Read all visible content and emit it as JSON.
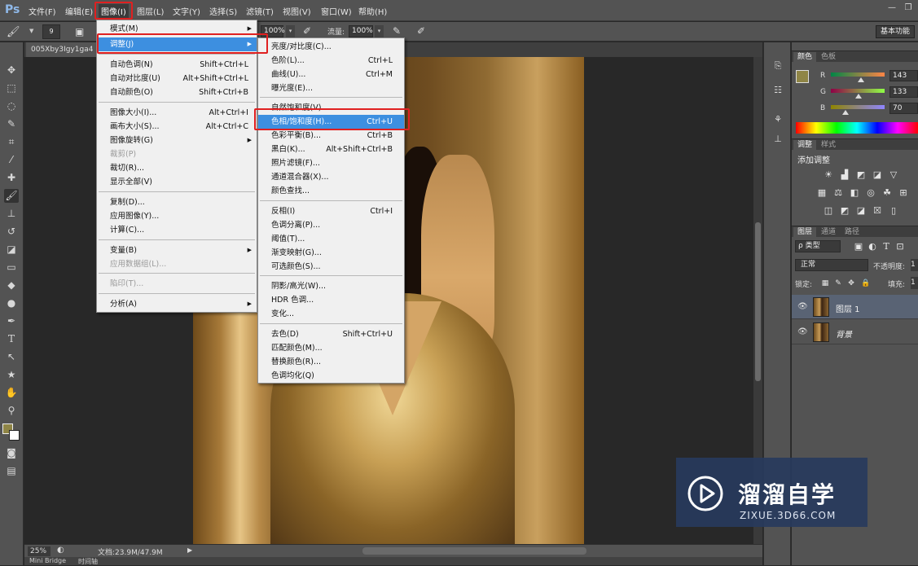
{
  "app": {
    "logo": "Ps"
  },
  "menubar": [
    "文件(F)",
    "编辑(E)",
    "图像(I)",
    "图层(L)",
    "文字(Y)",
    "选择(S)",
    "滤镜(T)",
    "视图(V)",
    "窗口(W)",
    "帮助(H)"
  ],
  "window_controls": {
    "minimize": "—",
    "restore": "❐"
  },
  "options": {
    "brush_size": "9",
    "opacity_value": "100%",
    "flow_label": "流量:",
    "flow_value": "100%",
    "workspace": "基本功能"
  },
  "document": {
    "tab": "005Xby3Igy1ga4",
    "zoom": "25%",
    "doc_size": "文档:23.9M/47.9M",
    "bottom_tabs": [
      "Mini Bridge",
      "时间轴"
    ]
  },
  "image_menu": {
    "items": [
      {
        "label": "模式(M)",
        "shortcut": "",
        "submenu": true,
        "disabled": false
      },
      {
        "label": "调整(J)",
        "shortcut": "",
        "submenu": true,
        "disabled": false,
        "highlight": true
      },
      {
        "label": "自动色调(N)",
        "shortcut": "Shift+Ctrl+L"
      },
      {
        "label": "自动对比度(U)",
        "shortcut": "Alt+Shift+Ctrl+L"
      },
      {
        "label": "自动颜色(O)",
        "shortcut": "Shift+Ctrl+B"
      },
      {
        "label": "图像大小(I)...",
        "shortcut": "Alt+Ctrl+I"
      },
      {
        "label": "画布大小(S)...",
        "shortcut": "Alt+Ctrl+C"
      },
      {
        "label": "图像旋转(G)",
        "shortcut": "",
        "submenu": true
      },
      {
        "label": "裁剪(P)",
        "shortcut": "",
        "disabled": true
      },
      {
        "label": "裁切(R)...",
        "shortcut": ""
      },
      {
        "label": "显示全部(V)",
        "shortcut": ""
      },
      {
        "label": "复制(D)...",
        "shortcut": ""
      },
      {
        "label": "应用图像(Y)...",
        "shortcut": ""
      },
      {
        "label": "计算(C)...",
        "shortcut": ""
      },
      {
        "label": "变量(B)",
        "shortcut": "",
        "submenu": true
      },
      {
        "label": "应用数据组(L)...",
        "shortcut": "",
        "disabled": true
      },
      {
        "label": "陷印(T)...",
        "shortcut": "",
        "disabled": true
      },
      {
        "label": "分析(A)",
        "shortcut": "",
        "submenu": true
      }
    ]
  },
  "adjust_menu": {
    "items": [
      {
        "label": "亮度/对比度(C)...",
        "shortcut": ""
      },
      {
        "label": "色阶(L)...",
        "shortcut": "Ctrl+L"
      },
      {
        "label": "曲线(U)...",
        "shortcut": "Ctrl+M"
      },
      {
        "label": "曝光度(E)...",
        "shortcut": ""
      },
      {
        "label": "自然饱和度(V)...",
        "shortcut": ""
      },
      {
        "label": "色相/饱和度(H)...",
        "shortcut": "Ctrl+U",
        "highlight": true
      },
      {
        "label": "色彩平衡(B)...",
        "shortcut": "Ctrl+B"
      },
      {
        "label": "黑白(K)...",
        "shortcut": "Alt+Shift+Ctrl+B"
      },
      {
        "label": "照片滤镜(F)...",
        "shortcut": ""
      },
      {
        "label": "通道混合器(X)...",
        "shortcut": ""
      },
      {
        "label": "颜色查找...",
        "shortcut": ""
      },
      {
        "label": "反相(I)",
        "shortcut": "Ctrl+I"
      },
      {
        "label": "色调分离(P)...",
        "shortcut": ""
      },
      {
        "label": "阈值(T)...",
        "shortcut": ""
      },
      {
        "label": "渐变映射(G)...",
        "shortcut": ""
      },
      {
        "label": "可选颜色(S)...",
        "shortcut": ""
      },
      {
        "label": "阴影/高光(W)...",
        "shortcut": ""
      },
      {
        "label": "HDR 色调...",
        "shortcut": ""
      },
      {
        "label": "变化...",
        "shortcut": ""
      },
      {
        "label": "去色(D)",
        "shortcut": "Shift+Ctrl+U"
      },
      {
        "label": "匹配颜色(M)...",
        "shortcut": ""
      },
      {
        "label": "替换颜色(R)...",
        "shortcut": ""
      },
      {
        "label": "色调均化(Q)",
        "shortcut": ""
      }
    ]
  },
  "color_panel": {
    "tabs": [
      "颜色",
      "色板"
    ],
    "r_label": "R",
    "g_label": "G",
    "b_label": "B",
    "r": "143",
    "g": "133",
    "b": "70",
    "r_level": 0.56,
    "g_level": 0.52,
    "b_level": 0.27,
    "foreground": "#8f8546"
  },
  "adjust_panel": {
    "tabs": [
      "调整",
      "样式"
    ],
    "title": "添加调整"
  },
  "layers_panel": {
    "tabs": [
      "图层",
      "通道",
      "路径"
    ],
    "filter": "ρ 类型",
    "blend": "正常",
    "opacity_label": "不透明度:",
    "opacity_value": "1",
    "lock_label": "锁定:",
    "fill_label": "填充:",
    "fill_value": "1",
    "layers": [
      {
        "name": "图层 1",
        "selected": true
      },
      {
        "name": "背景",
        "selected": false
      }
    ]
  },
  "watermark": {
    "title": "溜溜自学",
    "url": "ZIXUE.3D66.COM"
  }
}
